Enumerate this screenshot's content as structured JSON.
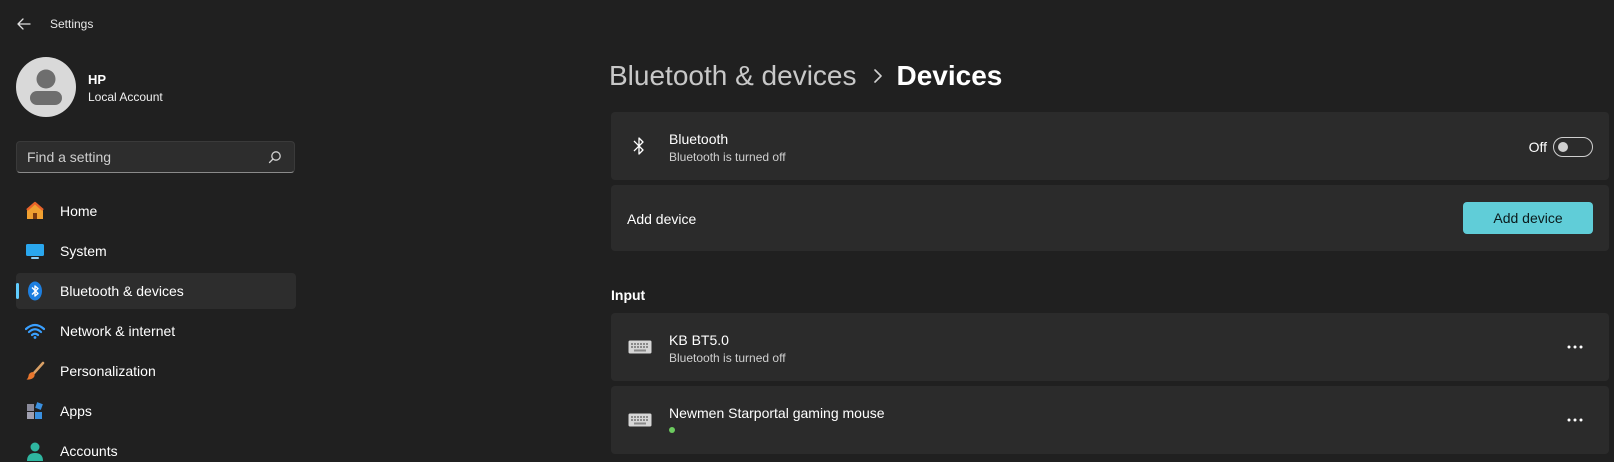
{
  "window": {
    "title": "Settings"
  },
  "profile": {
    "name": "HP",
    "account_type": "Local Account"
  },
  "search": {
    "placeholder": "Find a setting"
  },
  "sidebar": {
    "items": [
      {
        "label": "Home",
        "icon": "home-icon"
      },
      {
        "label": "System",
        "icon": "monitor-icon"
      },
      {
        "label": "Bluetooth & devices",
        "icon": "bluetooth-icon",
        "active": true
      },
      {
        "label": "Network & internet",
        "icon": "wifi-icon"
      },
      {
        "label": "Personalization",
        "icon": "brush-icon"
      },
      {
        "label": "Apps",
        "icon": "apps-icon"
      },
      {
        "label": "Accounts",
        "icon": "person-icon"
      }
    ]
  },
  "breadcrumb": {
    "parent": "Bluetooth & devices",
    "current": "Devices"
  },
  "bluetooth": {
    "title": "Bluetooth",
    "status": "Bluetooth is turned off",
    "toggle_state": "Off"
  },
  "add_device": {
    "label": "Add device",
    "button_label": "Add device"
  },
  "input_section": {
    "title": "Input",
    "devices": [
      {
        "name": "KB BT5.0",
        "status": "Bluetooth is turned off",
        "icon": "keyboard-icon"
      },
      {
        "name": "Newmen Starportal gaming mouse",
        "status": "",
        "connected": true,
        "icon": "keyboard-icon"
      }
    ]
  },
  "colors": {
    "accent": "#60cdff",
    "button": "#60cdd8",
    "background": "#202020",
    "card": "#2b2b2b",
    "connected_dot": "#6ccb5f"
  }
}
